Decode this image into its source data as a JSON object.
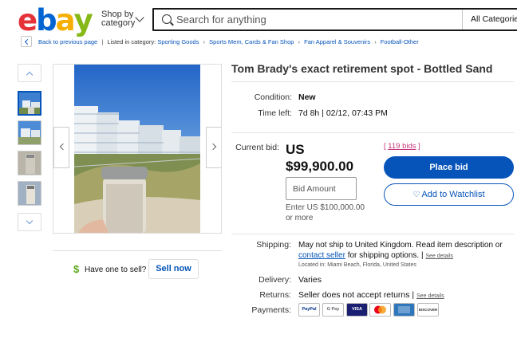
{
  "header": {
    "logo_letters": [
      "e",
      "b",
      "a",
      "y"
    ],
    "logo_colors": [
      "#e53238",
      "#0064d2",
      "#f5af02",
      "#86b817"
    ],
    "shop_by": [
      "Shop by",
      "category"
    ],
    "search_placeholder": "Search for anything",
    "all_categories": "All Categories"
  },
  "breadcrumb": {
    "back": "Back to previous page",
    "listed_in": "Listed in category:",
    "items": [
      "Sporting Goods",
      "Sports Mem, Cards & Fan Shop",
      "Fan Apparel & Souvenirs",
      "Football-Other"
    ]
  },
  "item": {
    "title": "Tom Brady's exact retirement spot -  Bottled Sand",
    "condition_label": "Condition:",
    "condition": "New",
    "time_left_label": "Time left:",
    "time_left": "7d 8h | 02/12, 07:43 PM",
    "current_bid_label": "Current bid:",
    "currency": "US",
    "current_bid": "$99,900.00",
    "bids_open": "[ ",
    "bids_link": "119 bids",
    "bids_close": " ]",
    "bid_placeholder": "Bid Amount",
    "enter_hint": "Enter US $100,000.00 or more",
    "place_bid": "Place bid",
    "add_watchlist": "Add to Watchlist"
  },
  "sell": {
    "icon": "dollar-icon",
    "prompt": "Have one to sell?",
    "button": "Sell now"
  },
  "shipping": {
    "label": "Shipping:",
    "text1": "May not ship to United Kingdom. Read item description or",
    "link": "contact seller",
    "text2": " for shipping options. | ",
    "see_details": "See details",
    "located": "Located in: Miami Beach, Florida, United States",
    "delivery_label": "Delivery:",
    "delivery": "Varies",
    "returns_label": "Returns:",
    "returns": "Seller does not accept returns | ",
    "returns_details": "See details",
    "payments_label": "Payments:",
    "payments": [
      "PayPal",
      "G Pay",
      "VISA",
      "",
      "",
      "DISCOVER"
    ]
  },
  "colors": {
    "link": "#0654ba",
    "accent": "#0654ba",
    "bids": "#c5357a"
  }
}
